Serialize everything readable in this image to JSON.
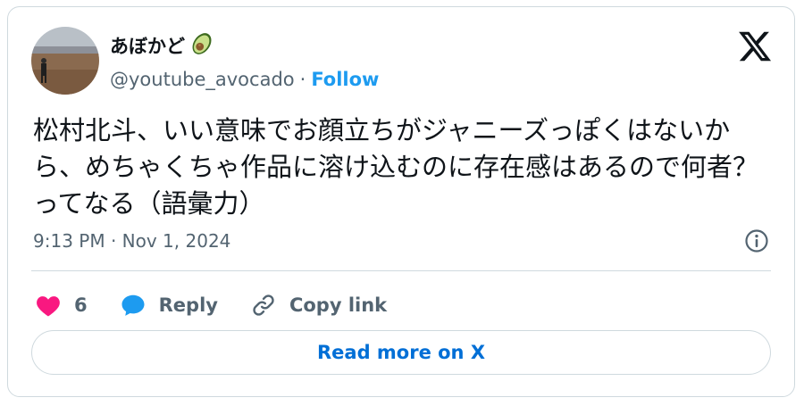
{
  "author": {
    "display_name": "あぼかど",
    "handle": "@youtube_avocado",
    "separator": "·",
    "follow_label": "Follow",
    "emoji_icon": "avocado-icon",
    "avatar_icon": "person-in-field"
  },
  "tweet": {
    "text": "松村北斗、いい意味でお顔立ちがジャニーズっぽくはないから、めちゃくちゃ作品に溶け込むのに存在感はあるので何者？ってなる（語彙力）",
    "timestamp": "9:13 PM · Nov 1, 2024"
  },
  "actions": {
    "like_count": "6",
    "reply_label": "Reply",
    "copy_label": "Copy link"
  },
  "footer": {
    "read_more_label": "Read more on X"
  },
  "colors": {
    "accent": "#1d9bf0",
    "like": "#f91880",
    "text": "#0f1419",
    "muted": "#536471",
    "border": "#cfd9de"
  }
}
